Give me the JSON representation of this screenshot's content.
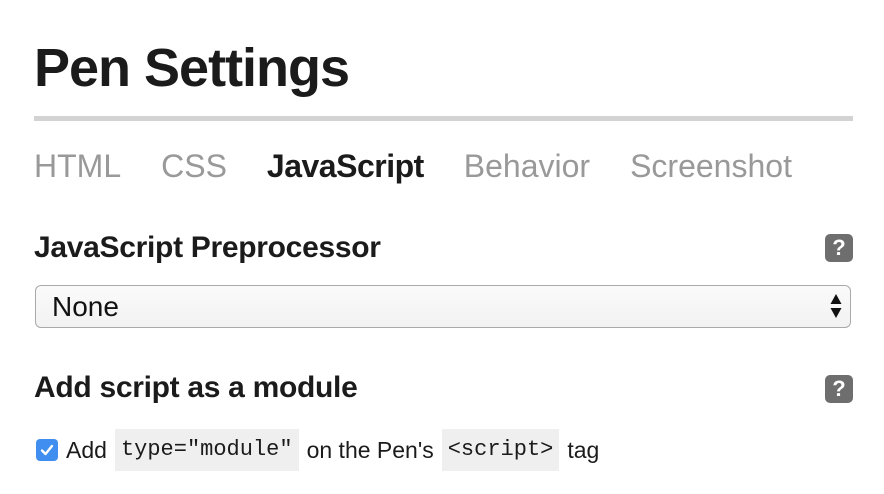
{
  "page_title": "Pen Settings",
  "tabs": [
    {
      "label": "HTML",
      "active": false
    },
    {
      "label": "CSS",
      "active": false
    },
    {
      "label": "JavaScript",
      "active": true
    },
    {
      "label": "Behavior",
      "active": false
    },
    {
      "label": "Screenshot",
      "active": false
    }
  ],
  "preprocessor": {
    "heading": "JavaScript Preprocessor",
    "help_icon_text": "?",
    "selected_value": "None"
  },
  "module": {
    "heading": "Add script as a module",
    "help_icon_text": "?",
    "checked": true,
    "text_before": "Add",
    "code_1": "type=\"module\"",
    "text_middle": "on the Pen's",
    "code_2": "<script>",
    "text_after": "tag"
  },
  "colors": {
    "checkbox_accent": "#3f8ef0",
    "help_icon_bg": "#6e6e6e",
    "inactive_tab": "#999999",
    "divider": "#d3d3d3"
  }
}
